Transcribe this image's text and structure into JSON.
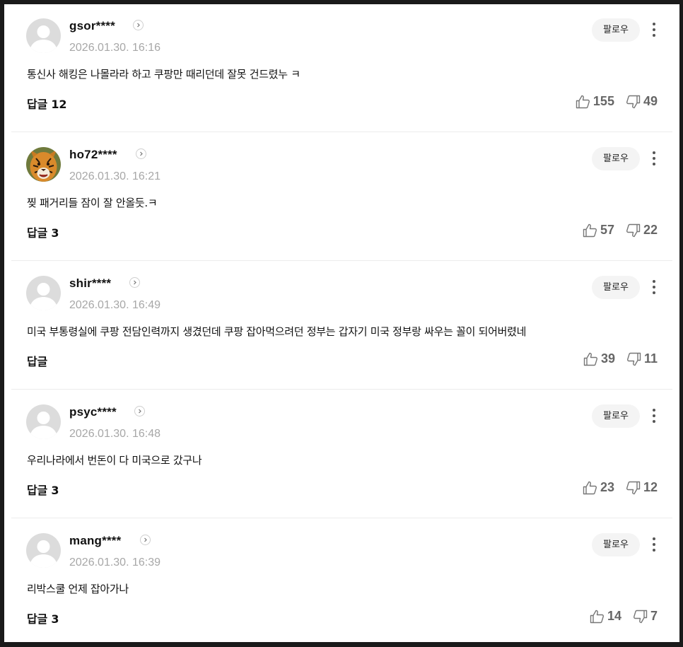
{
  "follow_label": "팔로우",
  "comments": [
    {
      "username": "gsor****",
      "timestamp": "2026.01.30. 16:16",
      "text": "통신사 해킹은 나몰라라 하고 쿠팡만 때리던데 잘못 건드렸누 ㅋ",
      "reply_label": "답글 12",
      "likes": "155",
      "dislikes": "49",
      "avatar": "default-avatar"
    },
    {
      "username": "ho72****",
      "timestamp": "2026.01.30. 16:21",
      "text": "찢 패거리들 잠이 잘 안올듯.ㅋ",
      "reply_label": "답글 3",
      "likes": "57",
      "dislikes": "22",
      "avatar": "tiger-avatar"
    },
    {
      "username": "shir****",
      "timestamp": "2026.01.30. 16:49",
      "text": "미국 부통령실에 쿠팡 전담인력까지 생겼던데 쿠팡 잡아먹으려던 정부는 갑자기 미국 정부랑 싸우는 꼴이 되어버렸네",
      "reply_label": "답글",
      "likes": "39",
      "dislikes": "11",
      "avatar": "default-avatar"
    },
    {
      "username": "psyc****",
      "timestamp": "2026.01.30. 16:48",
      "text": "우리나라에서 번돈이 다 미국으로 갔구나",
      "reply_label": "답글 3",
      "likes": "23",
      "dislikes": "12",
      "avatar": "default-avatar"
    },
    {
      "username": "mang****",
      "timestamp": "2026.01.30. 16:39",
      "text": "리박스쿨 언제 잡아가나",
      "reply_label": "답글 3",
      "likes": "14",
      "dislikes": "7",
      "avatar": "default-avatar"
    }
  ]
}
